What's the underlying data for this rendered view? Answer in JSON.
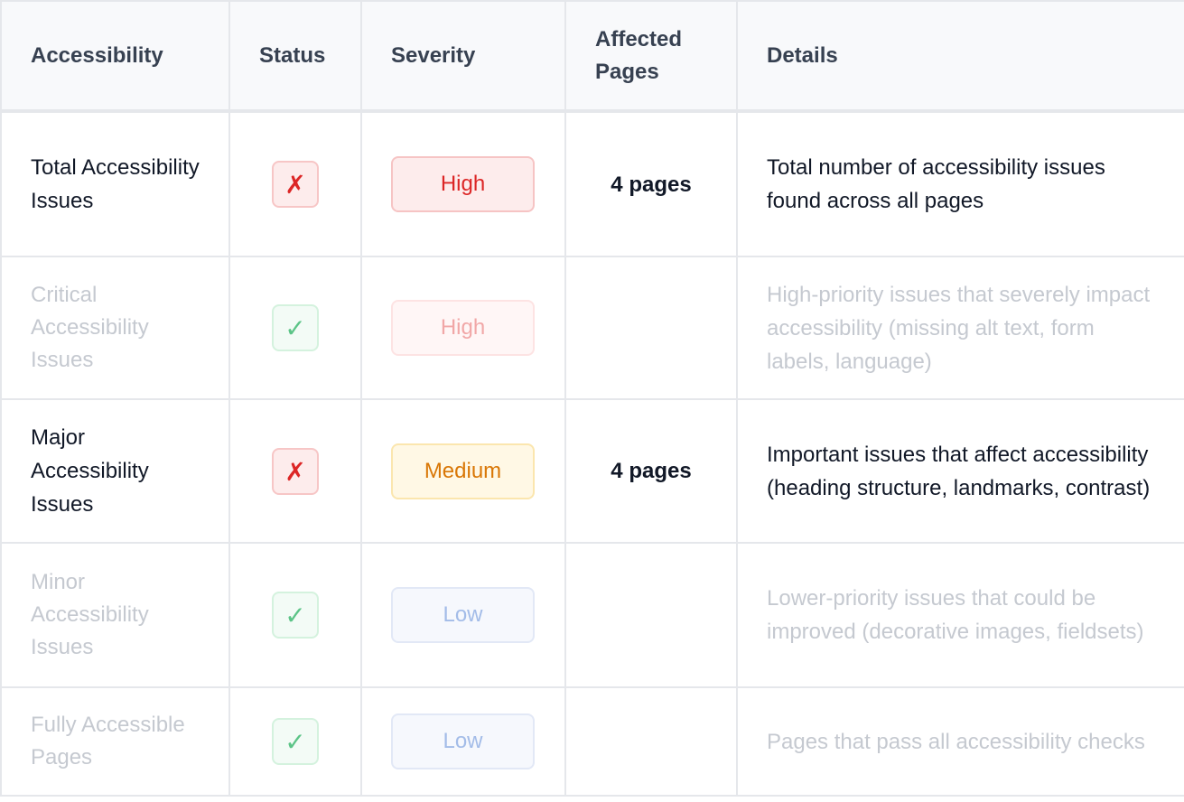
{
  "table": {
    "headers": {
      "accessibility": "Accessibility",
      "status": "Status",
      "severity": "Severity",
      "affected_pages": "Affected Pages",
      "details": "Details"
    },
    "rows": [
      {
        "name": "Total Accessibility Issues",
        "status_glyph": "✗",
        "status_icon": "x-icon",
        "severity": "High",
        "affected_pages": "4 pages",
        "details": "Total number of accessibility issues found across all pages"
      },
      {
        "name": "Critical Accessibility Issues",
        "status_glyph": "✓",
        "status_icon": "check-icon",
        "severity": "High",
        "affected_pages": "",
        "details": "High-priority issues that severely impact accessibility (missing alt text, form labels, language)"
      },
      {
        "name": "Major Accessibility Issues",
        "status_glyph": "✗",
        "status_icon": "x-icon",
        "severity": "Medium",
        "affected_pages": "4 pages",
        "details": "Important issues that affect accessibility (heading structure, landmarks, contrast)"
      },
      {
        "name": "Minor Accessibility Issues",
        "status_glyph": "✓",
        "status_icon": "check-icon",
        "severity": "Low",
        "affected_pages": "",
        "details": "Lower-priority issues that could be improved (decorative images, fieldsets)"
      },
      {
        "name": "Fully Accessible Pages",
        "status_glyph": "✓",
        "status_icon": "check-icon",
        "severity": "Low",
        "affected_pages": "",
        "details": "Pages that pass all accessibility checks"
      }
    ]
  },
  "colors": {
    "fail": "#dc2626",
    "pass": "#34b36a",
    "high": "#dc2626",
    "medium": "#d97706",
    "low": "#a3bce8",
    "muted_text": "#c5c9d0",
    "header_bg": "#f8f9fb",
    "border": "#e5e7eb"
  }
}
